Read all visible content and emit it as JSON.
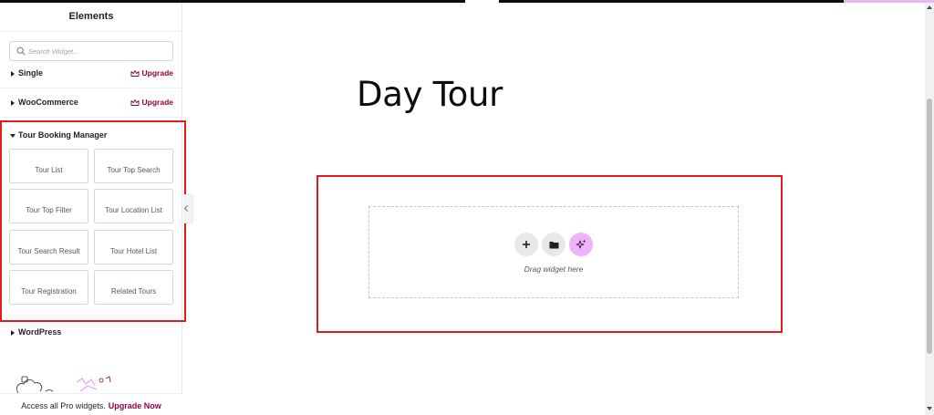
{
  "sidebar": {
    "title": "Elements",
    "search_placeholder": "Search Widget...",
    "categories": [
      {
        "label": "Single",
        "upgrade": "Upgrade"
      },
      {
        "label": "WooCommerce",
        "upgrade": "Upgrade"
      }
    ],
    "tour_booking": {
      "label": "Tour Booking Manager",
      "widgets": [
        "Tour List",
        "Tour Top Search",
        "Tour Top Filter",
        "Tour Location List",
        "Tour Search Result",
        "Tour Hotel List",
        "Tour Registration",
        "Related Tours"
      ]
    },
    "wordpress_label": "WordPress",
    "footer": {
      "text": "Access all Pro widgets.",
      "link": "Upgrade Now"
    }
  },
  "canvas": {
    "heading": "Day Tour",
    "drop_text": "Drag widget here"
  },
  "colors": {
    "accent": "#93003f",
    "highlight": "#e21b1b",
    "ai_button": "#f0b3fb"
  },
  "icons": [
    "search-icon",
    "crown-icon",
    "plus-icon",
    "folder-icon",
    "sparkle-icon",
    "chevron-left-icon"
  ]
}
